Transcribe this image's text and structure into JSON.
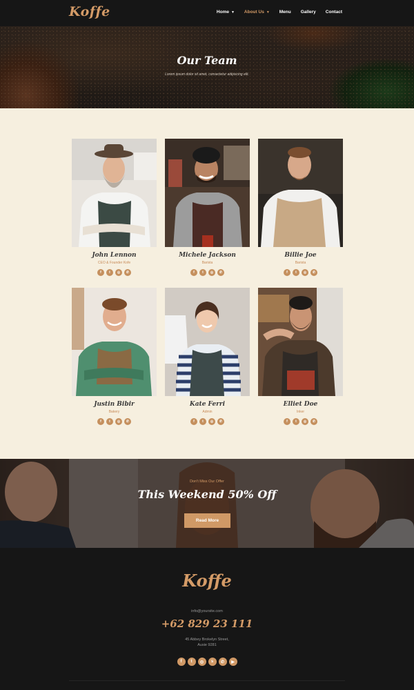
{
  "header": {
    "logo": "Koffe",
    "nav": [
      {
        "label": "Home",
        "dropdown": true,
        "active": false
      },
      {
        "label": "About Us",
        "dropdown": true,
        "active": true
      },
      {
        "label": "Menu",
        "dropdown": false,
        "active": false
      },
      {
        "label": "Gallery",
        "dropdown": false,
        "active": false
      },
      {
        "label": "Contact",
        "dropdown": false,
        "active": false
      }
    ]
  },
  "hero": {
    "title": "Our Team",
    "subtitle": "Lorem ipsum dolor sit amet, consectetur adipiscing elit."
  },
  "team": [
    {
      "name": "John Lennon",
      "role": "CEO & Founder Kofe"
    },
    {
      "name": "Michele Jackson",
      "role": "Barista"
    },
    {
      "name": "Billie Joe",
      "role": "Barista"
    },
    {
      "name": "Justin Bibir",
      "role": "Bakery"
    },
    {
      "name": "Kate Ferri",
      "role": "Admin"
    },
    {
      "name": "Elliet Doe",
      "role": "Inker"
    }
  ],
  "member_socials": [
    "facebook-icon",
    "twitter-icon",
    "instagram-icon",
    "whatsapp-icon"
  ],
  "promo": {
    "tag": "Don't Miss Our Offer",
    "title": "This Weekend 50% Off",
    "button": "Read More"
  },
  "footer": {
    "logo": "Koffe",
    "email": "info@yoursite.com",
    "phone": "+62 829 23 111",
    "address_line1": "45 Abbey Brokelyn Street,",
    "address_line2": "Ausie 9281",
    "socials": [
      "facebook-icon",
      "twitter-icon",
      "instagram-icon",
      "skype-icon",
      "whatsapp-icon",
      "youtube-icon"
    ]
  },
  "colors": {
    "accent": "#d49b67",
    "dark": "#161616",
    "cream": "#f6efdf"
  }
}
